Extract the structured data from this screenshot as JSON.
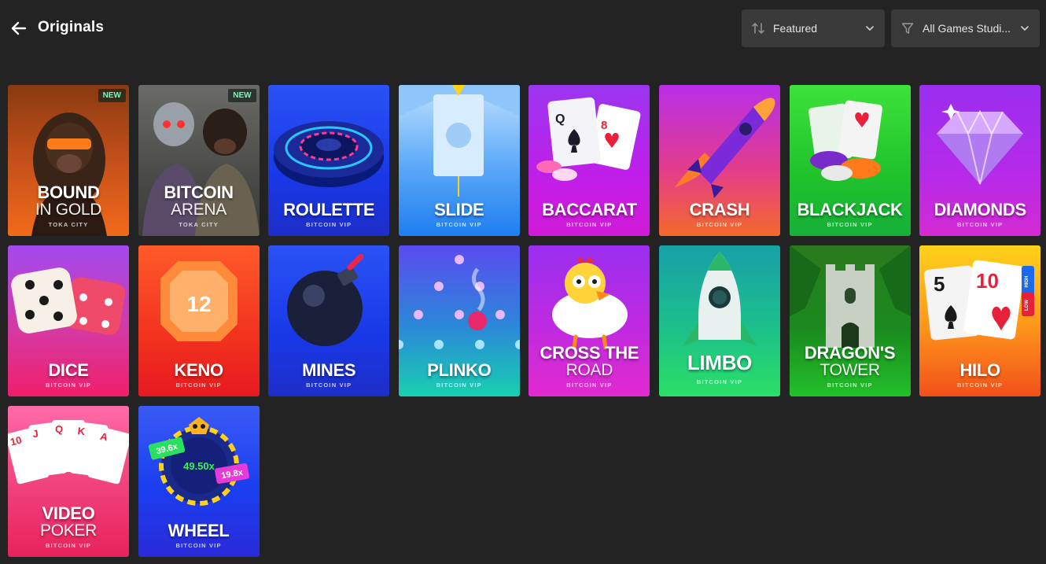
{
  "header": {
    "title": "Originals",
    "sort_label": "Featured",
    "filter_label": "All Games Studi..."
  },
  "games": [
    {
      "line1": "BOUND",
      "line2": "IN GOLD",
      "brand": "TOKA CITY",
      "badge": "NEW",
      "bg": "#e8601a"
    },
    {
      "line1": "BITCOIN",
      "line2": "ARENA",
      "brand": "TOKA CITY",
      "badge": "NEW",
      "bg": "#4a4a48"
    },
    {
      "line1": "ROULETTE",
      "line2": "",
      "brand": "BITCOIN VIP",
      "badge": "",
      "bg": "#1a3cf0"
    },
    {
      "line1": "SLIDE",
      "line2": "",
      "brand": "BITCOIN VIP",
      "badge": "",
      "bg": "#2f8ff5"
    },
    {
      "line1": "BACCARAT",
      "line2": "",
      "brand": "BITCOIN VIP",
      "badge": "",
      "bg": "#c21ee8"
    },
    {
      "line1": "CRASH",
      "line2": "",
      "brand": "BITCOIN VIP",
      "badge": "",
      "bg": "#e03a8a"
    },
    {
      "line1": "BLACKJACK",
      "line2": "",
      "brand": "BITCOIN VIP",
      "badge": "",
      "bg": "#22c230"
    },
    {
      "line1": "DIAMONDS",
      "line2": "",
      "brand": "BITCOIN VIP",
      "badge": "",
      "bg": "#b02ee8"
    },
    {
      "line1": "DICE",
      "line2": "",
      "brand": "BITCOIN VIP",
      "badge": "",
      "bg": "#d63aa0"
    },
    {
      "line1": "KENO",
      "line2": "",
      "brand": "BITCOIN VIP",
      "badge": "",
      "bg": "#f02a22"
    },
    {
      "line1": "MINES",
      "line2": "",
      "brand": "BITCOIN VIP",
      "badge": "",
      "bg": "#1a3cf0"
    },
    {
      "line1": "PLINKO",
      "line2": "",
      "brand": "BITCOIN VIP",
      "badge": "",
      "bg": "#2a9ad8"
    },
    {
      "line1": "CROSS THE",
      "line2": "ROAD",
      "brand": "BITCOIN VIP",
      "badge": "",
      "bg": "#c02ae0"
    },
    {
      "line1": "LIMBO",
      "line2": "",
      "brand": "BITCOIN VIP",
      "badge": "",
      "bg": "#1cc08a"
    },
    {
      "line1": "DRAGON'S",
      "line2": "TOWER",
      "brand": "BITCOIN VIP",
      "badge": "",
      "bg": "#1a8a1e"
    },
    {
      "line1": "HILO",
      "line2": "",
      "brand": "BITCOIN VIP",
      "badge": "",
      "bg": "#f25a1a"
    },
    {
      "line1": "VIDEO",
      "line2": "POKER",
      "brand": "BITCOIN VIP",
      "badge": "",
      "bg": "#f0286e"
    },
    {
      "line1": "WHEEL",
      "line2": "",
      "brand": "BITCOIN VIP",
      "badge": "",
      "bg": "#1a3cf0"
    }
  ],
  "art_text": {
    "keno_number": "12",
    "hilo_left": "5",
    "hilo_right": "10",
    "hilo_high": "HIGH",
    "hilo_low": "LOW",
    "wheel_center": "49.50x",
    "wheel_left": "39.6x",
    "wheel_right": "19.8x",
    "baccarat_q": "Q",
    "baccarat_8": "8",
    "poker_cards": [
      "10",
      "J",
      "Q",
      "K",
      "A"
    ]
  }
}
